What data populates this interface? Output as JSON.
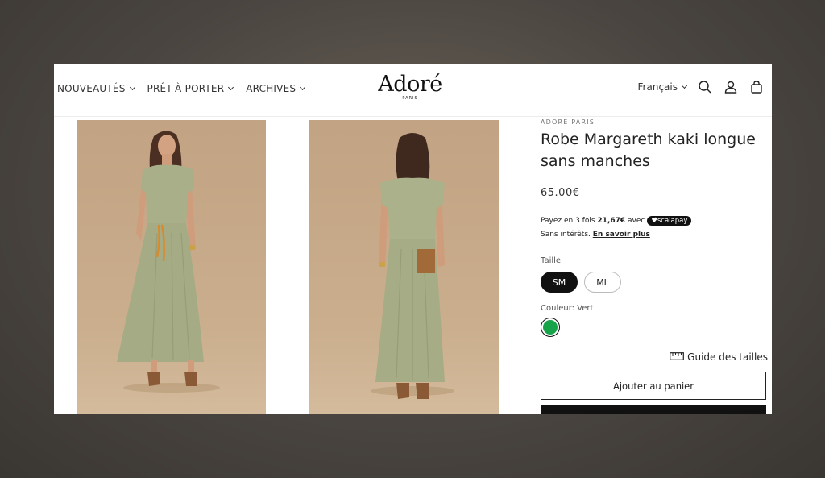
{
  "header": {
    "nav": [
      {
        "label": "NOUVEAUTÉS"
      },
      {
        "label": "PRÊT-À-PORTER"
      },
      {
        "label": "ARCHIVES"
      }
    ],
    "logo": {
      "main": "Adoré",
      "sub": "PARIS"
    },
    "language": "Français",
    "icons": [
      "search-icon",
      "account-icon",
      "cart-icon"
    ]
  },
  "product": {
    "vendor": "ADORE PARIS",
    "title": "Robe Margareth kaki longue sans manches",
    "price": "65.00€",
    "scalapay": {
      "line1_prefix": "Payez en 3 fois",
      "installment": "21,67€",
      "line1_suffix": "avec",
      "badge": "♥scalapay",
      "line2_prefix": "Sans intérêts.",
      "link": "En savoir plus"
    },
    "size_label": "Taille",
    "sizes": [
      {
        "label": "SM",
        "selected": true
      },
      {
        "label": "ML",
        "selected": false
      }
    ],
    "color_label": "Couleur: Vert",
    "color_swatch": "#16a34a",
    "size_guide": "Guide des tailles",
    "add_to_cart": "Ajouter au panier"
  },
  "colors": {
    "backdrop": "#4a4540",
    "photo_bg": "#c9ab89",
    "dress": "#a8ae87",
    "accent_black": "#111111"
  }
}
